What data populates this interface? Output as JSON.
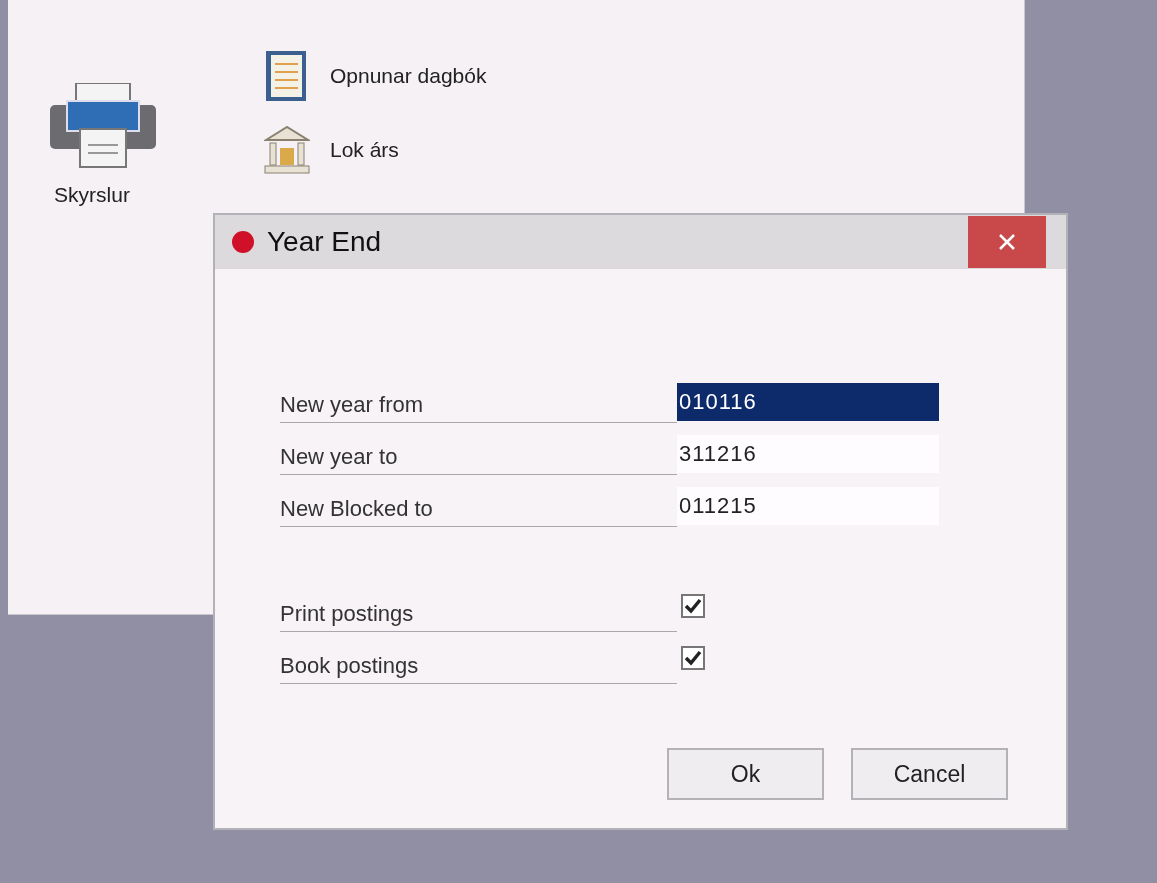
{
  "desktop": {
    "shortcuts": [
      {
        "label": "Skyrslur",
        "kind": "printer"
      }
    ],
    "menu_items": [
      {
        "label": "Opnunar dagbók",
        "kind": "journal"
      },
      {
        "label": "Lok árs",
        "kind": "bank"
      }
    ]
  },
  "dialog": {
    "title": "Year End",
    "fields": [
      {
        "label": "New year from",
        "value": "010116",
        "selected": true
      },
      {
        "label": "New year to",
        "value": "311216",
        "selected": false
      },
      {
        "label": "New Blocked to",
        "value": "011215",
        "selected": false
      }
    ],
    "checkboxes": [
      {
        "label": "Print postings",
        "checked": true
      },
      {
        "label": "Book postings",
        "checked": true
      }
    ],
    "buttons": [
      "Ok",
      "Cancel"
    ]
  }
}
